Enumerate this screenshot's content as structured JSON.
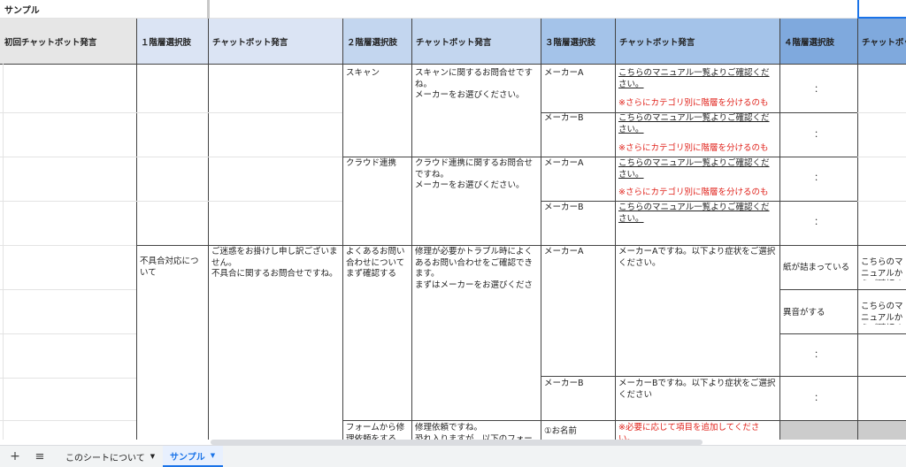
{
  "sheet_title": "サンプル",
  "headers": [
    "初回チャットボット発言",
    "１階層選択肢",
    "チャットボット発言",
    "２階層選択肢",
    "チャットボット発言",
    "３階層選択肢",
    "チャットボット発言",
    "４階層選択肢",
    "チャットボット"
  ],
  "colors": {
    "header_gray": "#e6e6e6",
    "header_lightblue": "#dbe4f4",
    "header_blue": "#a4c3e9",
    "header_deepblue": "#7fa9dd",
    "link_red": "#e0221b",
    "tab_active": "#e8f0fe"
  },
  "cells": {
    "scan_choice": "スキャン",
    "scan_msg": "スキャンに関するお問合せですね。\nメーカーをお選びください。",
    "makerA_1": "メーカーA",
    "manual_1": "こちらのマニュアル一覧よりご確認ください。",
    "note_1": "※さらにカテゴリ別に階層を分けるのも",
    "colon_1": "：",
    "makerB_1": "メーカーB",
    "manual_2": "こちらのマニュアル一覧よりご確認ください。",
    "note_2": "※さらにカテゴリ別に階層を分けるのも",
    "colon_2": "：",
    "cloud_choice": "クラウド連携",
    "cloud_msg": "クラウド連携に関するお問合せですね。\nメーカーをお選びください。",
    "makerA_2": "メーカーA",
    "manual_3": "こちらのマニュアル一覧よりご確認ください。",
    "note_3": "※さらにカテゴリ別に階層を分けるのも",
    "colon_3": "：",
    "makerB_2": "メーカーB",
    "manual_4": "こちらのマニュアル一覧よりご確認ください。",
    "colon_4": "：",
    "trouble_choice": "不具合対応について",
    "trouble_msg": "ご迷惑をお掛けし申し訳ございません。\n不具合に関するお問合せですね。",
    "faq_choice": "よくあるお問い合わせについてまず確認する",
    "faq_msg": "修理が必要かトラブル時によくあるお問い合わせをご確認できます。\nまずはメーカーをお選びくださ",
    "makerA_3": "メーカーA",
    "makerA_msg": "メーカーAですね。以下より症状をご選択ください。",
    "paper_jam": "紙が詰まっている",
    "paper_jam_msg": "こちらのマニュアルからご確認ください",
    "noise": "異音がする",
    "noise_msg": "こちらのマニュアルからご確認ください",
    "colon_5": "：",
    "colon_6": "：",
    "makerB_3": "メーカーB",
    "makerB_msg": "メーカーBですね。以下より症状をご選択ください",
    "form_choice": "フォームから修理依頼をする",
    "form_msg": "修理依頼ですね。\n恐れ入りますが、以下のフォー",
    "name_item": "①お名前",
    "add_note": "※必要に応じて項目を追加してください。"
  },
  "tabs": {
    "add_icon": "plus-icon",
    "menu_icon": "menu-icon",
    "sheet1": "このシートについて",
    "sheet2": "サンプル"
  }
}
